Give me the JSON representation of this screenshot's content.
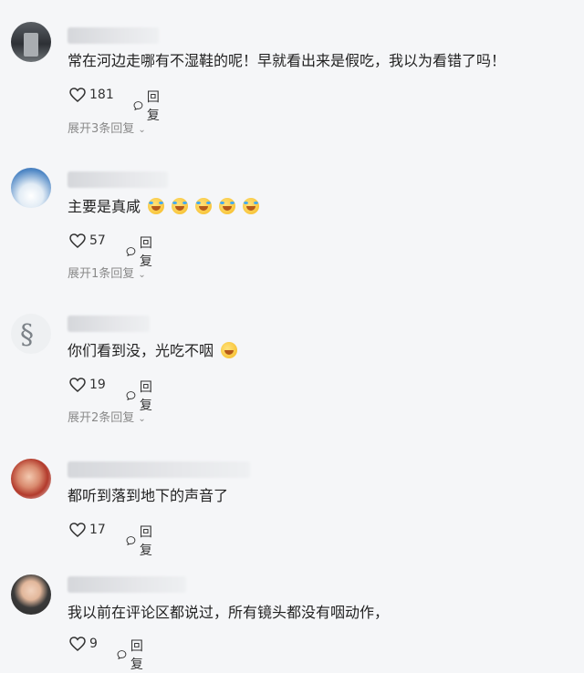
{
  "comments": [
    {
      "text": "常在河边走哪有不湿鞋的呢！早就看出来是假吃，我以为看错了吗！",
      "likes": "181",
      "reply_label": "回复",
      "expand": "展开3条回复",
      "emojis": 0
    },
    {
      "text": "主要是真咸",
      "likes": "57",
      "reply_label": "回复",
      "expand": "展开1条回复",
      "emojis": 5
    },
    {
      "text": "你们看到没，光吃不咽",
      "likes": "19",
      "reply_label": "回复",
      "expand": "展开2条回复",
      "emojis": 1
    },
    {
      "text": "都听到落到地下的声音了",
      "likes": "17",
      "reply_label": "回复",
      "expand": "",
      "emojis": 0
    },
    {
      "text": "我以前在评论区都说过，所有镜头都没有咽动作，",
      "likes": "9",
      "reply_label": "回复",
      "expand": "",
      "emojis": 0
    }
  ],
  "icons": {
    "like": "heart-outline-icon",
    "reply": "speech-bubble-icon",
    "expand": "chevron-down-icon",
    "emoji_laugh": "laughing-tears-emoji-icon",
    "emoji_smirk": "smirk-emoji-icon"
  },
  "colors": {
    "background": "#f5f6f8",
    "text": "#222222",
    "muted": "#8a8a8a"
  }
}
